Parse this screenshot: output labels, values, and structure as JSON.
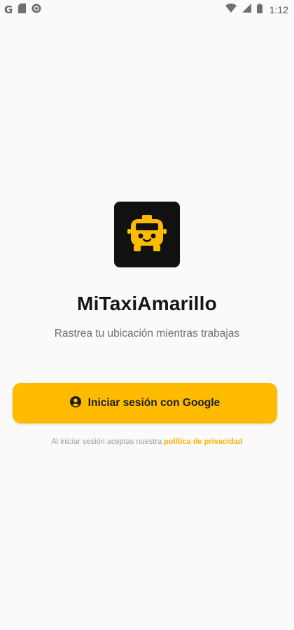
{
  "status_bar": {
    "time": "1:12",
    "left_icons": [
      "google-icon",
      "sd-card-icon",
      "circle-notification-icon"
    ],
    "right_icons": [
      "wifi-icon",
      "cellular-signal-icon",
      "battery-icon"
    ]
  },
  "app": {
    "logo_icon": "taxi-icon",
    "title": "MiTaxiAmarillo",
    "subtitle": "Rastrea tu ubicación mientras trabajas"
  },
  "login": {
    "button_label": "Iniciar sesión con Google",
    "button_icon": "account-circle-icon"
  },
  "privacy": {
    "prefix": "Al iniciar sesión aceptas nuestra",
    "link_label": "política de privacidad"
  },
  "colors": {
    "accent": "#ffbb00",
    "logo_bg": "#111111",
    "background": "#fafafa",
    "link": "#f5b400"
  }
}
